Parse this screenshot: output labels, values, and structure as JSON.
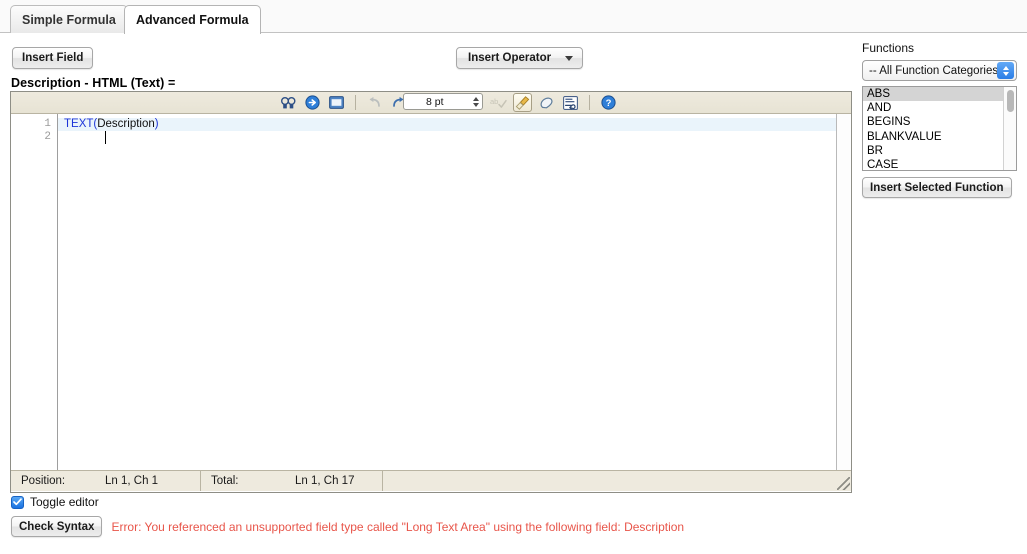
{
  "tabs": [
    {
      "label": "Simple Formula",
      "active": false
    },
    {
      "label": "Advanced Formula",
      "active": true
    }
  ],
  "toolbar": {
    "insert_field_label": "Insert Field",
    "insert_operator_label": "Insert Operator"
  },
  "field_label": "Description - HTML (Text) =",
  "editor": {
    "font_size_value": "8 pt",
    "icons": [
      "find-icon",
      "goto-line-icon",
      "panel-icon",
      "undo-icon",
      "redo-icon",
      "spellcheck-icon",
      "clean-icon",
      "eraser-icon",
      "wrap-text-icon",
      "help-icon"
    ],
    "lines": [
      {
        "number": "1",
        "fn": "TEXT(",
        "arg": "Description",
        "close": ")"
      },
      {
        "number": "2",
        "fn": "",
        "arg": "",
        "close": ""
      }
    ],
    "status": {
      "position_label": "Position:",
      "position_value": "Ln 1, Ch 1",
      "total_label": "Total:",
      "total_value": "Ln 1, Ch 17"
    }
  },
  "toggle_editor_label": "Toggle editor",
  "check_syntax_label": "Check Syntax",
  "error_message": "Error: You referenced an unsupported field type called \"Long Text Area\" using the following field: Description",
  "functions": {
    "title": "Functions",
    "category_selected": "-- All Function Categories --",
    "items": [
      "ABS",
      "AND",
      "BEGINS",
      "BLANKVALUE",
      "BR",
      "CASE"
    ],
    "selected_item": "ABS",
    "insert_button_label": "Insert Selected Function"
  },
  "colors": {
    "error": "#e8554a",
    "token_function": "#1d35d8",
    "selection": "#d4d4d4",
    "current_line": "#eaf4fb",
    "toolbar_bg": "#eeeade"
  }
}
